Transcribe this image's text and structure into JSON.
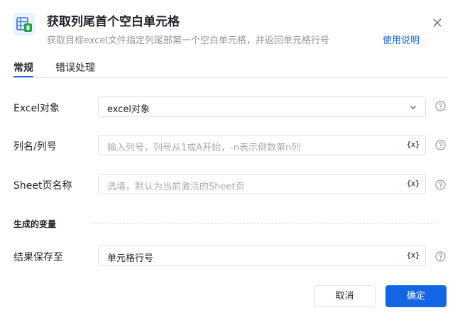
{
  "dialog": {
    "title": "获取列尾首个空白单元格",
    "subtitle": "获取目标excel文件指定列尾部第一个空白单元格，并返回单元格行号",
    "help_link": "使用说明"
  },
  "tabs": [
    {
      "label": "常规",
      "active": true
    },
    {
      "label": "错误处理",
      "active": false
    }
  ],
  "fields": {
    "excel_object": {
      "label": "Excel对象",
      "value": "excel对象"
    },
    "column": {
      "label": "列名/列号",
      "value": "",
      "placeholder": "输入列号，列号从1或A开始，-n表示倒数第n列"
    },
    "sheet": {
      "label": "Sheet页名称",
      "value": "",
      "placeholder": "选填，默认为当前激活的Sheet页"
    }
  },
  "variables_section": {
    "title": "生成的变量",
    "result": {
      "label": "结果保存至",
      "value": "单元格行号"
    }
  },
  "var_icon_text": "{x}",
  "buttons": {
    "cancel": "取消",
    "ok": "确定"
  },
  "colors": {
    "accent": "#1366e6",
    "excel_green": "#18a84a"
  }
}
